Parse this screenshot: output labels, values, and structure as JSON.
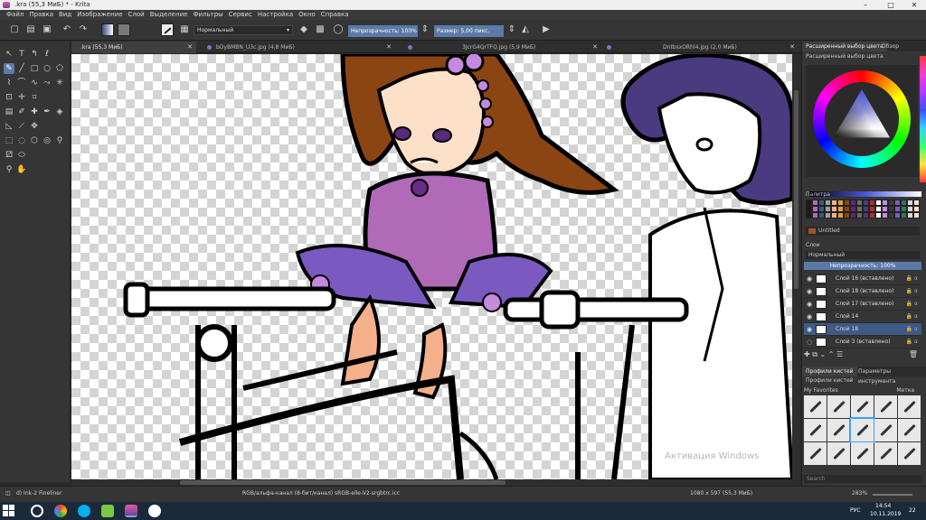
{
  "window": {
    "title": ".kra (55,3 МиБ) * - Krita",
    "minimize": "–",
    "maximize": "□",
    "close": "✕"
  },
  "menu": [
    "Файл",
    "Правка",
    "Вид",
    "Изображение",
    "Слой",
    "Выделение",
    "Фильтры",
    "Сервис",
    "Настройка",
    "Окно",
    "Справка"
  ],
  "toolbar": {
    "blend_mode": "Нормальный",
    "opacity": "Непрозрачность: 100%",
    "size": "Размер: 5,00 пикс."
  },
  "tabs": [
    {
      "label": ".kra (55,3 МиБ)",
      "active": true
    },
    {
      "label": "bDyBMBN_U3c.jpg (4,8 МиБ)",
      "active": false
    },
    {
      "label": "3JcrG4QrTFQ.jpg (5,9 МиБ)",
      "active": false
    },
    {
      "label": "DntbsxORhl4.jpg (2,0 МиБ)",
      "active": false
    }
  ],
  "docker": {
    "color_tabs": [
      "Расширенный выбор цвета",
      "Обзор"
    ],
    "color_title": "Расширенный выбор цвета",
    "palette_title": "Палитра",
    "palette_name": "Untitled",
    "layers_title": "Слои",
    "layers_blend": "Нормальный",
    "layers_opacity": "Непрозрачность: 100%",
    "layers": [
      {
        "name": "Слой 16 (вставлено)",
        "selected": false
      },
      {
        "name": "Слой 18 (вставлено)",
        "selected": false
      },
      {
        "name": "Слой 17 (вставлено)",
        "selected": false
      },
      {
        "name": "Слой 14",
        "selected": false
      },
      {
        "name": "Слой 18",
        "selected": true
      },
      {
        "name": "Слой 3 (вставлено)",
        "selected": false
      }
    ],
    "brush_tabs": [
      "Профили кистей",
      "Параметры инструмента"
    ],
    "brush_title": "Профили кистей",
    "brush_filter": "My Favorites",
    "brush_tag": "Метка",
    "search_placeholder": "Search"
  },
  "status": {
    "brush": "d) Ink-2 Fineliner",
    "colorspace": "RGB/альфа-канал (8-бит/канал)  sRGB-elle-V2-srgbtrc.icc",
    "dimensions": "1080 x 597 (55,3 МиБ)",
    "zoom": "283%"
  },
  "taskbar": {
    "lang": "РУС",
    "time": "14:54",
    "date": "10.11.2019",
    "notif": "22"
  },
  "watermark": "Активация Windows",
  "colors": {
    "accent": "#5b7aa8",
    "panel": "#353535",
    "dark": "#2b2b2b"
  }
}
